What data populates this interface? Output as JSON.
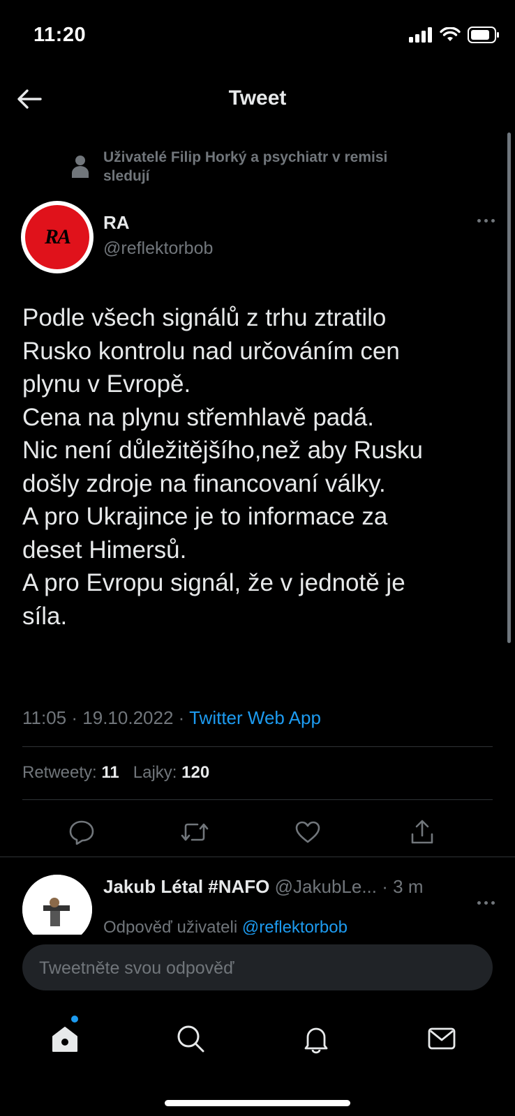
{
  "status_bar": {
    "time": "11:20"
  },
  "nav": {
    "title": "Tweet"
  },
  "social_context": {
    "text": "Uživatelé Filip Horký a psychiatr v remisi sledují"
  },
  "tweet": {
    "author": {
      "name": "RA",
      "handle": "@reflektorbob",
      "avatar_text": "RA"
    },
    "body_lines": [
      "Podle všech signálů z trhu ztratilo",
      "Rusko kontrolu nad určováním cen",
      "plynu v Evropě.",
      "Cena na plynu střemhlavě padá.",
      "Nic není důležitějšího,než aby Rusku",
      "došly zdroje na financovaní války.",
      "A pro Ukrajince je to informace za",
      "deset Himersů.",
      "A pro Evropu signál, že v jednotě je",
      "síla."
    ],
    "time": "11:05",
    "date": "19.10.2022",
    "source": "Twitter Web App",
    "separator": "·",
    "stats": {
      "retweets_label": "Retweety:",
      "retweets": "11",
      "likes_label": "Lajky:",
      "likes": "120"
    }
  },
  "reply": {
    "name": "Jakub Létal #NAFO",
    "handle": "@JakubLe...",
    "time_ago": "3 m",
    "reply_to_label": "Odpověď uživateli",
    "reply_to_handle": "@reflektorbob"
  },
  "compose": {
    "placeholder": "Tweetněte svou odpověď"
  },
  "colors": {
    "accent": "#1d9bf0",
    "background": "#000000",
    "secondary_text": "#71767b",
    "avatar_red": "#e0121b"
  },
  "icons": [
    "back-arrow-icon",
    "reply-icon",
    "retweet-icon",
    "like-icon",
    "share-icon",
    "home-icon",
    "search-icon",
    "notifications-icon",
    "messages-icon"
  ]
}
